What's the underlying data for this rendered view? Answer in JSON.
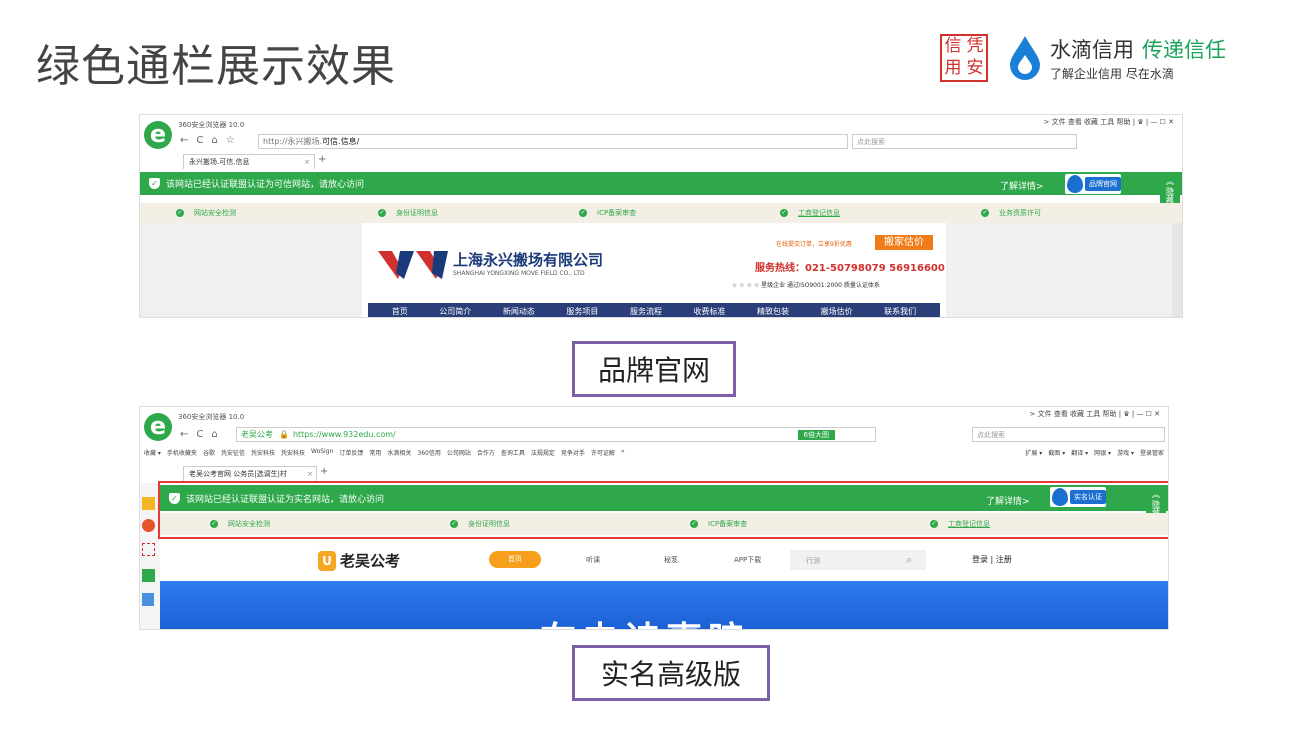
{
  "slide": {
    "title": "绿色通栏展示效果",
    "seal_chars": [
      "信",
      "凭",
      "用",
      "安"
    ],
    "brand_name": "水滴信用",
    "brand_slogan": "传递信任",
    "brand_tagline": "了解企业信用 尽在水滴"
  },
  "shot1": {
    "window_title": "360安全浏览器 10.0",
    "menu": "> 文件  查看  收藏  工具  帮助 | ♛ | — ☐ ✕",
    "url_prefix": "http://永兴搬场.",
    "url_domain": "可信.信息/",
    "search_placeholder": "点此搜索",
    "tab_label": "永兴搬场.可信.信息",
    "banner_text": "该网站已经认证联盟认证为可信网站，请放心访问",
    "detail_link": "了解详情>",
    "badge_label": "品牌官网",
    "hide_label": "隐藏",
    "checks": [
      "网站安全检测",
      "身份证明信息",
      "ICP备案审查",
      "工商登记信息",
      "业务资质许可"
    ],
    "site": {
      "company_cn": "上海永兴搬场有限公司",
      "company_en": "SHANGHAI YONGXING MOVE FIELD CO., LTD",
      "promo": "在线提交订单，立享9折优惠",
      "estimate_button": "搬家估价",
      "hotline": "服务热线：021-50798079  56916600",
      "cert": "☆ ☆ ☆ ☆ 星级企业  通过ISO9001:2000 质量认证体系",
      "nav": [
        "首页",
        "公司简介",
        "新闻动态",
        "服务项目",
        "服务流程",
        "收费标准",
        "精致包装",
        "搬场估价",
        "联系我们"
      ]
    },
    "caption": "品牌官网"
  },
  "shot2": {
    "window_title": "360安全浏览器 10.0",
    "menu": "> 文件  查看  收藏  工具  帮助 | ♛ | — ☐ ✕",
    "site_chip": "老吴公考",
    "url": "https://www.932edu.com/",
    "zoom_chip": "6倍大图",
    "search_placeholder": "点此搜索",
    "bookmarks": [
      "收藏 ▾",
      "手机收藏夹",
      "谷歌",
      "凭安征信",
      "凭安科技",
      "凭安科技",
      "WoSign",
      "订单反馈",
      "常用",
      "水滴相关",
      "360信用",
      "公司网站",
      "合作方",
      "查询工具",
      "法规规定",
      "竞争对手",
      "许可证解",
      "»"
    ],
    "bookmarks_right": [
      "扩展 ▾",
      "截图 ▾",
      "翻译 ▾",
      "网银 ▾",
      "游戏 ▾",
      "登录管家"
    ],
    "tab_label": "老吴公考官网 公务员|选调生|村",
    "banner_text": "该网站已经认证联盟认证为实名网站，请放心访问",
    "detail_link": "了解详情>",
    "badge_label": "实名认证",
    "hide_label": "隐藏",
    "checks": [
      "网站安全检测",
      "身份证明信息",
      "ICP备案审查",
      "工商登记信息"
    ],
    "site": {
      "logo_text": "老吴公考",
      "nav": [
        "首页",
        "听课",
        "秘笈",
        "APP下载"
      ],
      "search_placeholder": "行测",
      "login": "登录",
      "register": "注册",
      "hero_text": "在史诗事暗"
    },
    "caption": "实名高级版"
  },
  "colors": {
    "green": "#2ea84a",
    "caption_border": "#7b5ea6",
    "highlight": "#e53935",
    "nav_bg": "#2a3e7a"
  }
}
